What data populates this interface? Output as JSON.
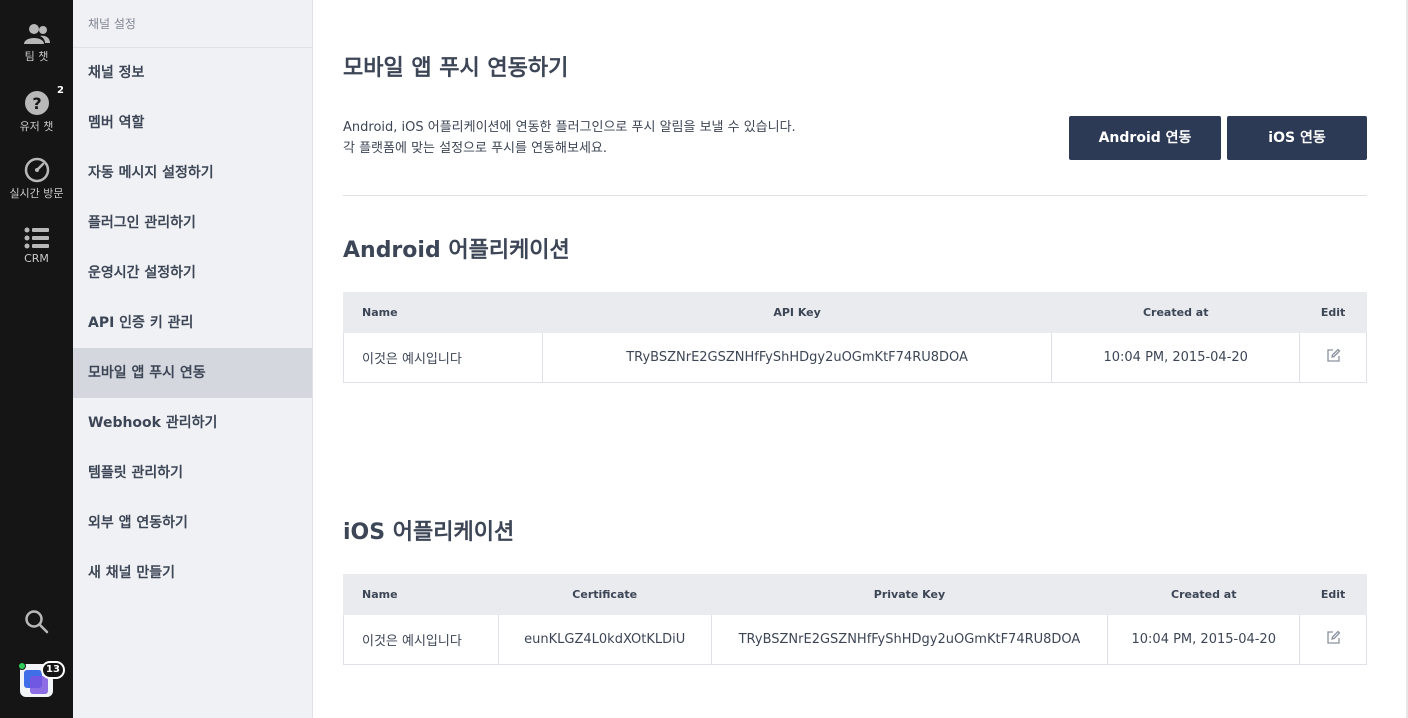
{
  "rail": {
    "items": [
      {
        "label": "팀 챗",
        "icon": "team-chat-icon"
      },
      {
        "label": "유저 챗",
        "icon": "user-chat-icon",
        "badge": "2"
      },
      {
        "label": "실시간 방문",
        "icon": "realtime-visit-icon"
      },
      {
        "label": "CRM",
        "icon": "crm-list-icon"
      }
    ],
    "search_icon": "search-icon",
    "avatar_badge": "13"
  },
  "nav": {
    "header": "채널 설정",
    "items": [
      {
        "label": "채널 정보"
      },
      {
        "label": "멤버 역할"
      },
      {
        "label": "자동 메시지 설정하기"
      },
      {
        "label": "플러그인 관리하기"
      },
      {
        "label": "운영시간 설정하기"
      },
      {
        "label": "API 인증 키 관리"
      },
      {
        "label": "모바일 앱 푸시 연동",
        "active": true
      },
      {
        "label": "Webhook 관리하기"
      },
      {
        "label": "템플릿 관리하기"
      },
      {
        "label": "외부 앱 연동하기"
      },
      {
        "label": "새 채널 만들기"
      }
    ]
  },
  "main": {
    "title": "모바일 앱 푸시 연동하기",
    "desc_line1": "Android, iOS 어플리케이션에 연동한 플러그인으로 푸시 알림을 보낼 수 있습니다.",
    "desc_line2": "각 플랫폼에 맞는 설정으로 푸시를 연동해보세요.",
    "android_button": "Android 연동",
    "ios_button": "iOS 연동",
    "android_section": {
      "title": "Android 어플리케이션",
      "columns": [
        "Name",
        "API Key",
        "Created at",
        "Edit"
      ],
      "rows": [
        {
          "name": "이것은 예시입니다",
          "api_key": "TRyBSZNrE2GSZNHfFyShHDgy2uOGmKtF74RU8DOA",
          "created_at": "10:04 PM, 2015-04-20"
        }
      ]
    },
    "ios_section": {
      "title": "iOS 어플리케이션",
      "columns": [
        "Name",
        "Certificate",
        "Private Key",
        "Created at",
        "Edit"
      ],
      "rows": [
        {
          "name": "이것은 예시입니다",
          "certificate": "eunKLGZ4L0kdXOtKLDiU",
          "private_key": "TRyBSZNrE2GSZNHfFyShHDgy2uOGmKtF74RU8DOA",
          "created_at": "10:04 PM, 2015-04-20"
        }
      ]
    }
  },
  "colors": {
    "rail_bg": "#151515",
    "nav_bg": "#f0f1f4",
    "nav_active": "#d4d7dd",
    "button_bg": "#2d3a55",
    "table_header_bg": "#e9ebee",
    "text": "#3d4656"
  }
}
